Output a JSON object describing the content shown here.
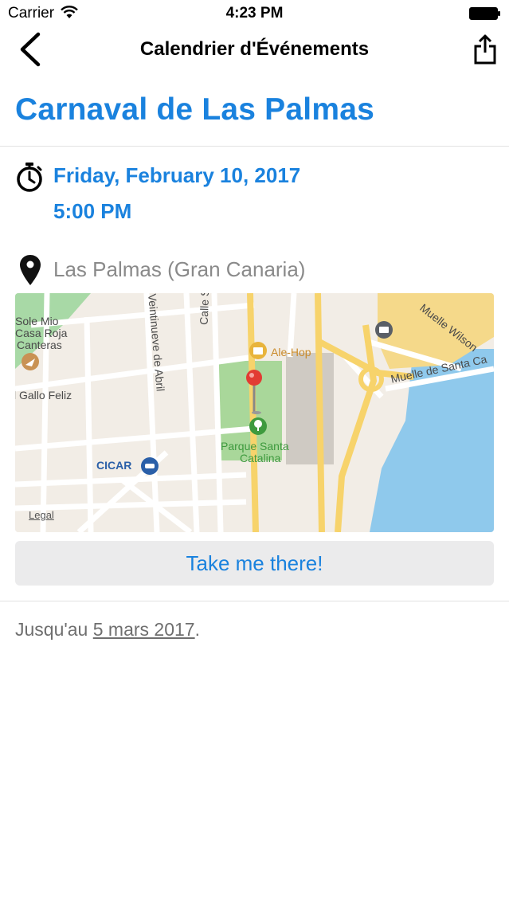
{
  "status_bar": {
    "carrier": "Carrier",
    "time": "4:23 PM"
  },
  "nav": {
    "title": "Calendrier d'Événements"
  },
  "event": {
    "title": "Carnaval de Las Palmas",
    "date": "Friday, February 10, 2017",
    "time": "5:00 PM",
    "location": "Las Palmas (Gran Canaria)"
  },
  "map": {
    "labels": {
      "sole_mio": "Sole Mio",
      "casa_roja": "Casa Roja",
      "canteras": "Canteras",
      "gallo_feliz": "l Gallo Feliz",
      "cicar": "CICAR",
      "ale_hop": "Ale-Hop",
      "parque_1": "Parque Santa",
      "parque_2": "Catalina",
      "muelle_santa": "Muelle de Santa Ca",
      "muelle_wilson": "Muelle Wilson",
      "veintinueve": "Veintinueve de Abril",
      "calle": "Calle S",
      "legal": "Legal"
    }
  },
  "actions": {
    "take_me_there": "Take me there!"
  },
  "footer": {
    "until_prefix": "Jusqu'au ",
    "until_date": "5 mars 2017",
    "until_suffix": "."
  },
  "colors": {
    "accent": "#1a82de",
    "secondary_text": "#8a8a8a",
    "button_bg": "#ebebec"
  },
  "icons": [
    "wifi-icon",
    "battery-icon",
    "back-chevron-icon",
    "share-icon",
    "timer-icon",
    "location-pin-icon"
  ]
}
